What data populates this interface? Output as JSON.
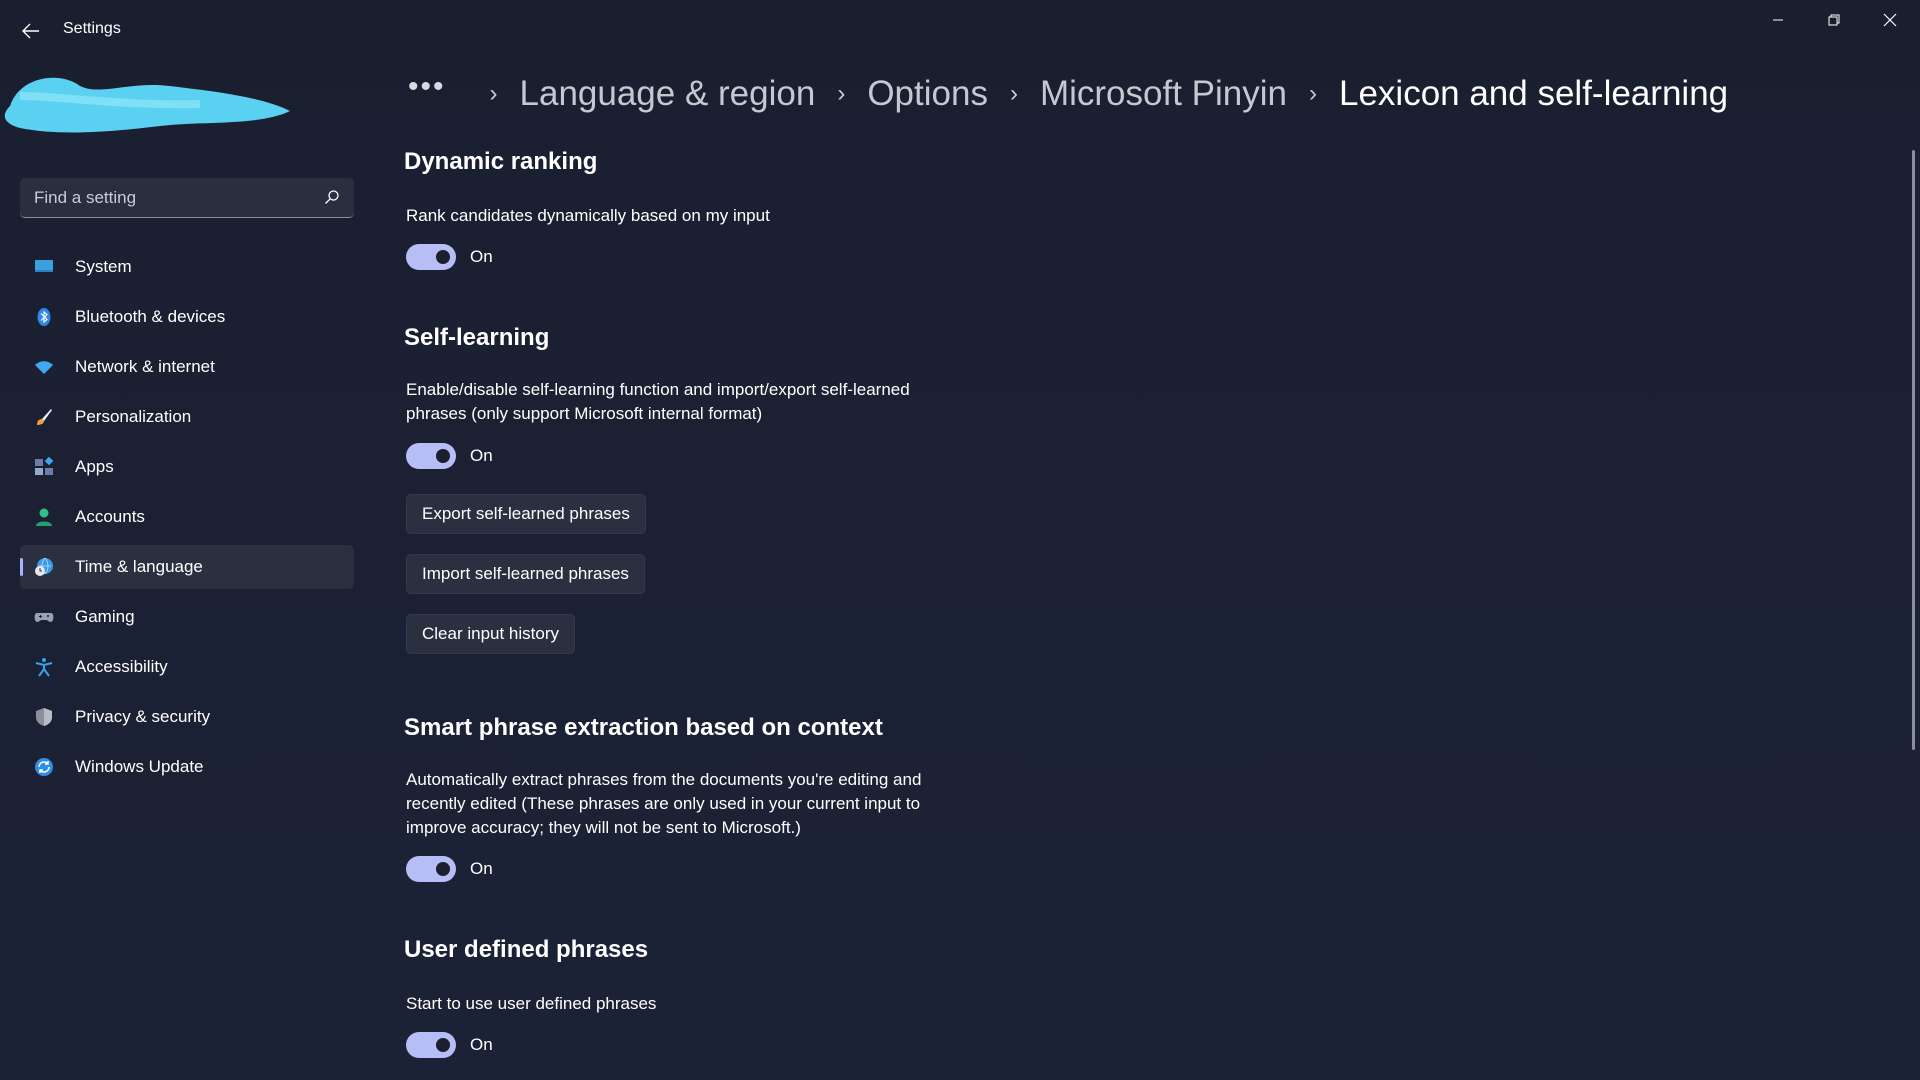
{
  "window": {
    "title": "Settings"
  },
  "search": {
    "placeholder": "Find a setting"
  },
  "sidebar": {
    "items": [
      {
        "label": "System",
        "icon": "monitor-icon"
      },
      {
        "label": "Bluetooth & devices",
        "icon": "bluetooth-icon"
      },
      {
        "label": "Network & internet",
        "icon": "wifi-icon"
      },
      {
        "label": "Personalization",
        "icon": "paintbrush-icon"
      },
      {
        "label": "Apps",
        "icon": "apps-icon"
      },
      {
        "label": "Accounts",
        "icon": "person-icon"
      },
      {
        "label": "Time & language",
        "icon": "globe-clock-icon",
        "active": true
      },
      {
        "label": "Gaming",
        "icon": "gamepad-icon"
      },
      {
        "label": "Accessibility",
        "icon": "accessibility-icon"
      },
      {
        "label": "Privacy & security",
        "icon": "shield-icon"
      },
      {
        "label": "Windows Update",
        "icon": "update-icon"
      }
    ]
  },
  "breadcrumb": {
    "more": "•••",
    "items": [
      "Language & region",
      "Options",
      "Microsoft Pinyin"
    ],
    "current": "Lexicon and self-learning",
    "separator": "›"
  },
  "sections": {
    "dynamic_ranking": {
      "title": "Dynamic ranking",
      "description": "Rank candidates dynamically based on my input",
      "toggle_state": "On"
    },
    "self_learning": {
      "title": "Self-learning",
      "description": "Enable/disable self-learning function and import/export self-learned phrases (only support Microsoft internal format)",
      "toggle_state": "On",
      "export_button": "Export self-learned phrases",
      "import_button": "Import self-learned phrases",
      "clear_button": "Clear input history"
    },
    "smart_phrase": {
      "title": "Smart phrase extraction based on context",
      "description": "Automatically extract phrases from the documents you're editing and recently edited (These phrases are only used in your current input to improve accuracy; they will not be sent to Microsoft.)",
      "toggle_state": "On"
    },
    "user_defined": {
      "title": "User defined phrases",
      "description": "Start to use user defined phrases",
      "toggle_state": "On"
    }
  },
  "colors": {
    "accent": "#b7bef6",
    "background": "#1b2032",
    "sidebar_active": "#2b3040"
  }
}
